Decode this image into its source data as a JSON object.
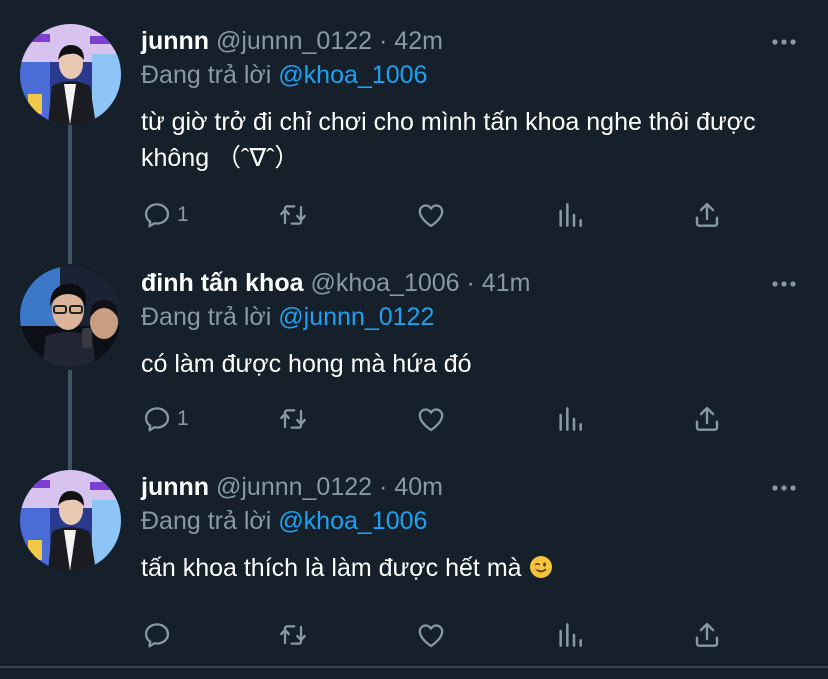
{
  "tweets": [
    {
      "display_name": "junnn",
      "handle": "@junnn_0122",
      "dot": "·",
      "time": "42m",
      "reply_prefix": "Đang trả lời",
      "reply_to": "@khoa_1006",
      "text": "từ giờ trở đi chỉ chơi cho mình tấn khoa nghe thôi được không （ˆ∇ˆ）",
      "reply_count": "1",
      "avatar_icon": "user-avatar-junnn"
    },
    {
      "display_name": "đinh tấn khoa",
      "handle": "@khoa_1006",
      "dot": "·",
      "time": "41m",
      "reply_prefix": "Đang trả lời",
      "reply_to": "@junnn_0122",
      "text": "có làm được hong mà hứa đó",
      "reply_count": "1",
      "avatar_icon": "user-avatar-khoa"
    },
    {
      "display_name": "junnn",
      "handle": "@junnn_0122",
      "dot": "·",
      "time": "40m",
      "reply_prefix": "Đang trả lời",
      "reply_to": "@khoa_1006",
      "text": "tấn khoa thích là làm được hết mà",
      "reply_count": "",
      "avatar_icon": "user-avatar-junnn",
      "emoji": "winking-face"
    }
  ],
  "icons": {
    "more": "more-horizontal-icon",
    "reply": "reply-bubble-icon",
    "retweet": "retweet-icon",
    "like": "heart-icon",
    "stats": "analytics-icon",
    "share": "share-icon"
  },
  "colors": {
    "background": "#15202b",
    "secondary_text": "#8899a6",
    "mention": "#1da1f2",
    "thread_line": "#3d5466",
    "separator": "#38444d"
  }
}
